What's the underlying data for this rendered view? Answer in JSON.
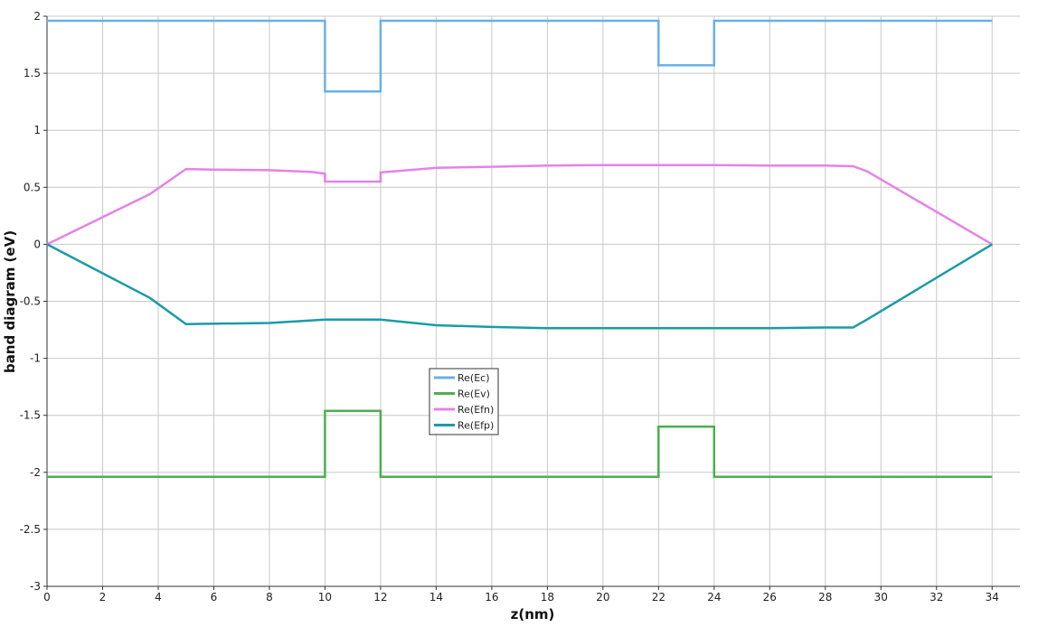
{
  "chart_data": {
    "type": "line",
    "title": "",
    "xlabel": "z(nm)",
    "ylabel": "band diagram (eV)",
    "xlim": [
      0,
      35
    ],
    "ylim": [
      -3,
      2
    ],
    "xticks": [
      0,
      2,
      4,
      6,
      8,
      10,
      12,
      14,
      16,
      18,
      20,
      22,
      24,
      26,
      28,
      30,
      32,
      34
    ],
    "yticks": [
      -3,
      -2.5,
      -2,
      -1.5,
      -1,
      -0.5,
      0,
      0.5,
      1,
      1.5,
      2
    ],
    "ytick_labels": [
      "-3",
      "-2.5",
      "-2",
      "-1.5",
      "-1",
      "-0.5",
      "0",
      "0.5",
      "1",
      "1.5",
      "2"
    ],
    "grid": true,
    "legend_position": "center-left",
    "series": [
      {
        "name": "Re(Ec)",
        "color": "#6ab0e6",
        "x": [
          0,
          10,
          10,
          12,
          12,
          22,
          22,
          24,
          24,
          34
        ],
        "y": [
          1.96,
          1.96,
          1.34,
          1.34,
          1.96,
          1.96,
          1.57,
          1.57,
          1.96,
          1.96
        ]
      },
      {
        "name": "Re(Ev)",
        "color": "#4caf50",
        "x": [
          0,
          10,
          10,
          12,
          12,
          22,
          22,
          24,
          24,
          34
        ],
        "y": [
          -2.04,
          -2.04,
          -1.46,
          -1.46,
          -2.04,
          -2.04,
          -1.6,
          -1.6,
          -2.04,
          -2.04
        ]
      },
      {
        "name": "Re(Efn)",
        "color": "#e582e8",
        "x": [
          0,
          3.7,
          5,
          6,
          8,
          9.5,
          10,
          10,
          12,
          12,
          14,
          16,
          18,
          20,
          22,
          24,
          26,
          28,
          29,
          29.5,
          34
        ],
        "y": [
          0,
          0.44,
          0.66,
          0.655,
          0.65,
          0.635,
          0.62,
          0.55,
          0.55,
          0.63,
          0.67,
          0.68,
          0.69,
          0.695,
          0.695,
          0.695,
          0.69,
          0.69,
          0.685,
          0.64,
          0
        ]
      },
      {
        "name": "Re(Efp)",
        "color": "#1a9ba8",
        "x": [
          0,
          3.7,
          5,
          8,
          10,
          12,
          14,
          16,
          18,
          20,
          22,
          24,
          26,
          28,
          29,
          29.5,
          34
        ],
        "y": [
          0,
          -0.47,
          -0.7,
          -0.69,
          -0.66,
          -0.66,
          -0.71,
          -0.725,
          -0.735,
          -0.735,
          -0.735,
          -0.735,
          -0.735,
          -0.73,
          -0.73,
          -0.66,
          0
        ]
      }
    ]
  }
}
